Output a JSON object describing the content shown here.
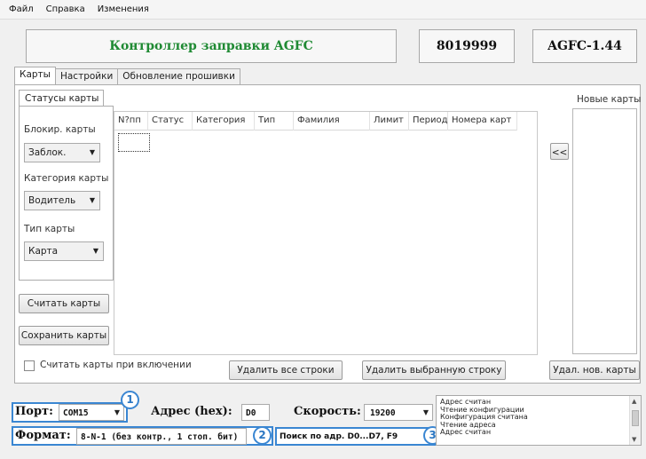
{
  "menu": [
    "Файл",
    "Справка",
    "Изменения"
  ],
  "header": {
    "title": "Контроллер заправки AGFC",
    "serial": "8019999",
    "version": "AGFC-1.44"
  },
  "tabs": [
    "Карты",
    "Настройки",
    "Обновление прошивки"
  ],
  "card_status": {
    "subtab": "Статусы карты",
    "block_label": "Блокир. карты",
    "block_value": "Заблок.",
    "category_label": "Категория карты",
    "category_value": "Водитель",
    "type_label": "Тип карты",
    "type_value": "Карта"
  },
  "buttons": {
    "read_cards": "Считать карты",
    "save_cards": "Сохранить карты",
    "move_left": "<<",
    "delete_all": "Удалить все строки",
    "delete_selected": "Удалить выбранную строку",
    "delete_new": "Удал. нов. карты"
  },
  "grid": {
    "columns": [
      "N?пп",
      "Статус",
      "Категория",
      "Тип",
      "Фамилия",
      "Лимит",
      "Период",
      "Номера карт"
    ]
  },
  "new_cards_label": "Новые карты",
  "read_on_start_label": "Считать карты при включении",
  "connection": {
    "port_label": "Порт:",
    "port_value": "COM15",
    "address_label": "Адрес (hex):",
    "address_value": "D0",
    "speed_label": "Скорость:",
    "speed_value": "19200",
    "format_label": "Формат:",
    "format_value": "8-N-1 (без контр., 1 стоп. бит)",
    "search_value": "Поиск по адр. D0...D7, F9"
  },
  "badges": [
    "1",
    "2",
    "3"
  ],
  "log": [
    "Адрес считан",
    "Чтение конфигурации",
    "Конфигурация считана",
    "Чтение адреса",
    "Адрес считан"
  ],
  "icons": {
    "dropdown": "chevron-down-icon",
    "scroll_up": "arrow-up-icon",
    "scroll_down": "arrow-down-icon"
  },
  "colors": {
    "title_green": "#1f8a33",
    "highlight_blue": "#3a86d2"
  }
}
